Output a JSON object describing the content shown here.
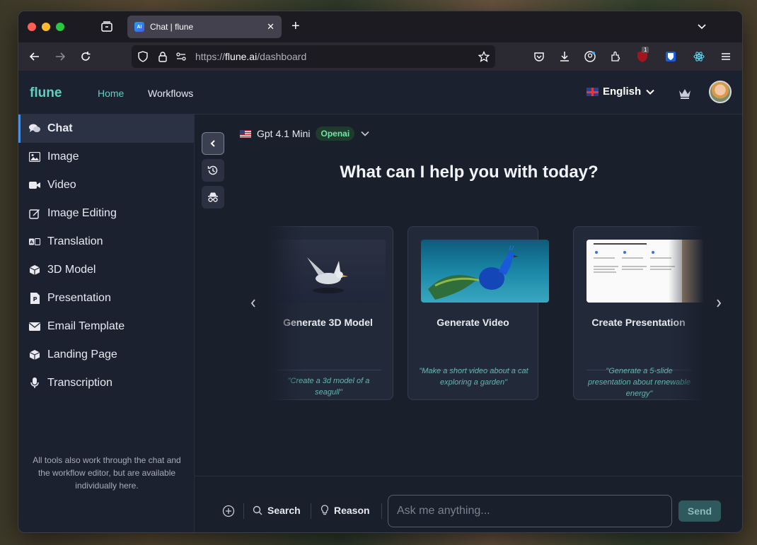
{
  "browser": {
    "tab_title": "Chat | flune",
    "tab_favicon_text": "AI",
    "url_scheme": "https://",
    "url_host": "flune.ai",
    "url_path": "/dashboard",
    "extension_badge": "1"
  },
  "header": {
    "logo": "flune",
    "nav": [
      {
        "label": "Home"
      },
      {
        "label": "Workflows"
      }
    ],
    "language": "English"
  },
  "sidebar": {
    "items": [
      {
        "label": "Chat",
        "icon": "chat-icon"
      },
      {
        "label": "Image",
        "icon": "image-icon"
      },
      {
        "label": "Video",
        "icon": "video-icon"
      },
      {
        "label": "Image Editing",
        "icon": "edit-icon"
      },
      {
        "label": "Translation",
        "icon": "translate-icon"
      },
      {
        "label": "3D Model",
        "icon": "cube-icon"
      },
      {
        "label": "Presentation",
        "icon": "presentation-icon"
      },
      {
        "label": "Email Template",
        "icon": "envelope-icon"
      },
      {
        "label": "Landing Page",
        "icon": "cube-icon"
      },
      {
        "label": "Transcription",
        "icon": "microphone-icon"
      }
    ],
    "note": "All tools also work through the chat and the workflow editor, but are available individually here."
  },
  "main": {
    "model_name": "Gpt 4.1 Mini",
    "model_provider": "Openai",
    "headline": "What can I help you with today?",
    "cards": [
      {
        "title": "Generate 3D Model",
        "quote": "\"Create a 3d model of a seagull\""
      },
      {
        "title": "Generate Video",
        "quote": "\"Make a short video about a cat exploring a garden\""
      },
      {
        "title": "Create Presentation",
        "quote": "\"Generate a 5-slide presentation about renewable energy\""
      }
    ]
  },
  "composer": {
    "search_label": "Search",
    "reason_label": "Reason",
    "placeholder": "Ask me anything...",
    "send_label": "Send"
  },
  "colors": {
    "accent": "#5fd0c0",
    "sidebar_active": "#4a90e2",
    "badge_text": "#6ee7a8"
  }
}
